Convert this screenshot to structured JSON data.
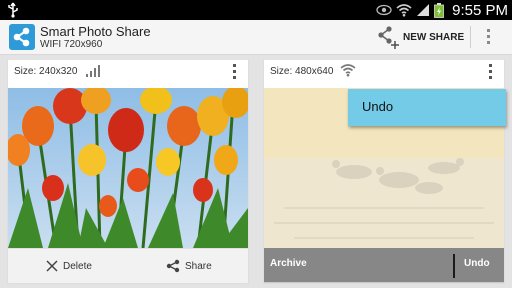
{
  "status_bar": {
    "time": "9:55 PM",
    "icons": [
      "usb-icon",
      "eye-icon",
      "wifi-icon",
      "signal-icon",
      "battery-charging-icon"
    ]
  },
  "action_bar": {
    "app_icon": "share-icon",
    "title": "Smart Photo Share",
    "subtitle": "WIFI 720x960",
    "new_share_label": "NEW SHARE",
    "new_share_icon": "share-add-icon",
    "overflow_icon": "overflow-menu-icon"
  },
  "cards": [
    {
      "size_label": "Size: 240x320",
      "connection_icon": "cellular-signal-icon",
      "photo": "red and yellow tulips against blue sky",
      "delete_label": "Delete",
      "share_label": "Share"
    },
    {
      "size_label": "Size: 480x640",
      "connection_icon": "wifi-icon",
      "photo": "geese on frozen water, faded",
      "archive_label": "Archive",
      "undo_label": "Undo"
    }
  ],
  "popup": {
    "label": "Undo"
  },
  "colors": {
    "accent": "#2f9ad8",
    "popup": "#74cbe8",
    "dark_footer": "#878787"
  }
}
